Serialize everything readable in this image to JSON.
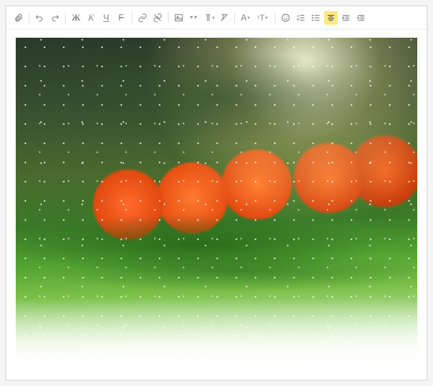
{
  "toolbar": {
    "attach": "📎",
    "undo": "↶",
    "redo": "↷",
    "bold": "Ж",
    "italic": "К",
    "underline": "Ч",
    "strike": "F",
    "font_color": "A",
    "font_size": "тТ",
    "emoji": "☺",
    "align_active": "align-center"
  },
  "content": {
    "image_alt": "Orange Christmas ornaments on pine branches with snow"
  }
}
